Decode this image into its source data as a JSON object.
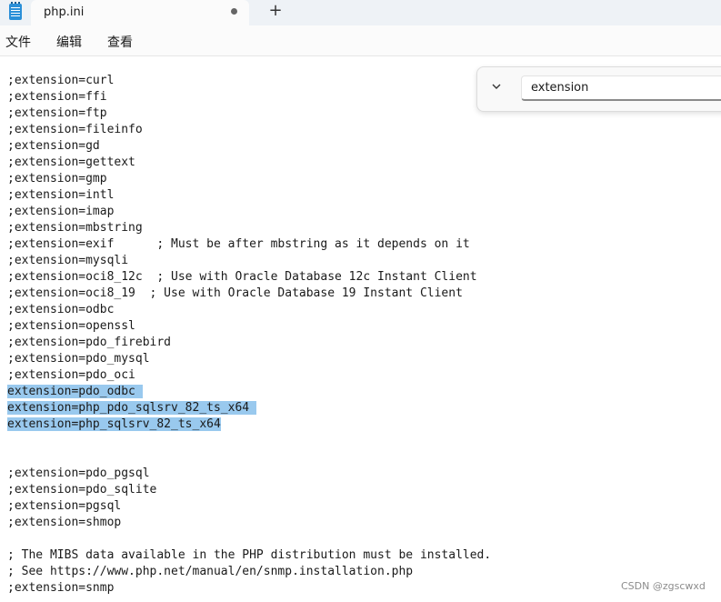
{
  "tab": {
    "title": "php.ini",
    "new_tab_symbol": "+"
  },
  "menu": {
    "file": "文件",
    "edit": "编辑",
    "view": "查看"
  },
  "find": {
    "query": "extension"
  },
  "editor": {
    "lines": [
      {
        "text": ";extension=curl",
        "selected": false
      },
      {
        "text": ";extension=ffi",
        "selected": false
      },
      {
        "text": ";extension=ftp",
        "selected": false
      },
      {
        "text": ";extension=fileinfo",
        "selected": false
      },
      {
        "text": ";extension=gd",
        "selected": false
      },
      {
        "text": ";extension=gettext",
        "selected": false
      },
      {
        "text": ";extension=gmp",
        "selected": false
      },
      {
        "text": ";extension=intl",
        "selected": false
      },
      {
        "text": ";extension=imap",
        "selected": false
      },
      {
        "text": ";extension=mbstring",
        "selected": false
      },
      {
        "text": ";extension=exif      ; Must be after mbstring as it depends on it",
        "selected": false
      },
      {
        "text": ";extension=mysqli",
        "selected": false
      },
      {
        "text": ";extension=oci8_12c  ; Use with Oracle Database 12c Instant Client",
        "selected": false
      },
      {
        "text": ";extension=oci8_19  ; Use with Oracle Database 19 Instant Client",
        "selected": false
      },
      {
        "text": ";extension=odbc",
        "selected": false
      },
      {
        "text": ";extension=openssl",
        "selected": false
      },
      {
        "text": ";extension=pdo_firebird",
        "selected": false
      },
      {
        "text": ";extension=pdo_mysql",
        "selected": false
      },
      {
        "text": ";extension=pdo_oci",
        "selected": false
      },
      {
        "text": "extension=pdo_odbc ",
        "selected": true
      },
      {
        "text": "extension=php_pdo_sqlsrv_82_ts_x64 ",
        "selected": true
      },
      {
        "text": "extension=php_sqlsrv_82_ts_x64",
        "selected": true
      },
      {
        "text": "",
        "selected": false
      },
      {
        "text": "",
        "selected": false
      },
      {
        "text": ";extension=pdo_pgsql",
        "selected": false
      },
      {
        "text": ";extension=pdo_sqlite",
        "selected": false
      },
      {
        "text": ";extension=pgsql",
        "selected": false
      },
      {
        "text": ";extension=shmop",
        "selected": false
      },
      {
        "text": "",
        "selected": false
      },
      {
        "text": "; The MIBS data available in the PHP distribution must be installed.",
        "selected": false
      },
      {
        "text": "; See https://www.php.net/manual/en/snmp.installation.php",
        "selected": false
      },
      {
        "text": ";extension=snmp",
        "selected": false
      }
    ]
  },
  "watermark": "CSDN @zgscwxd",
  "colors": {
    "selection": "#99c9ee",
    "titlebar": "#eef2f6"
  }
}
